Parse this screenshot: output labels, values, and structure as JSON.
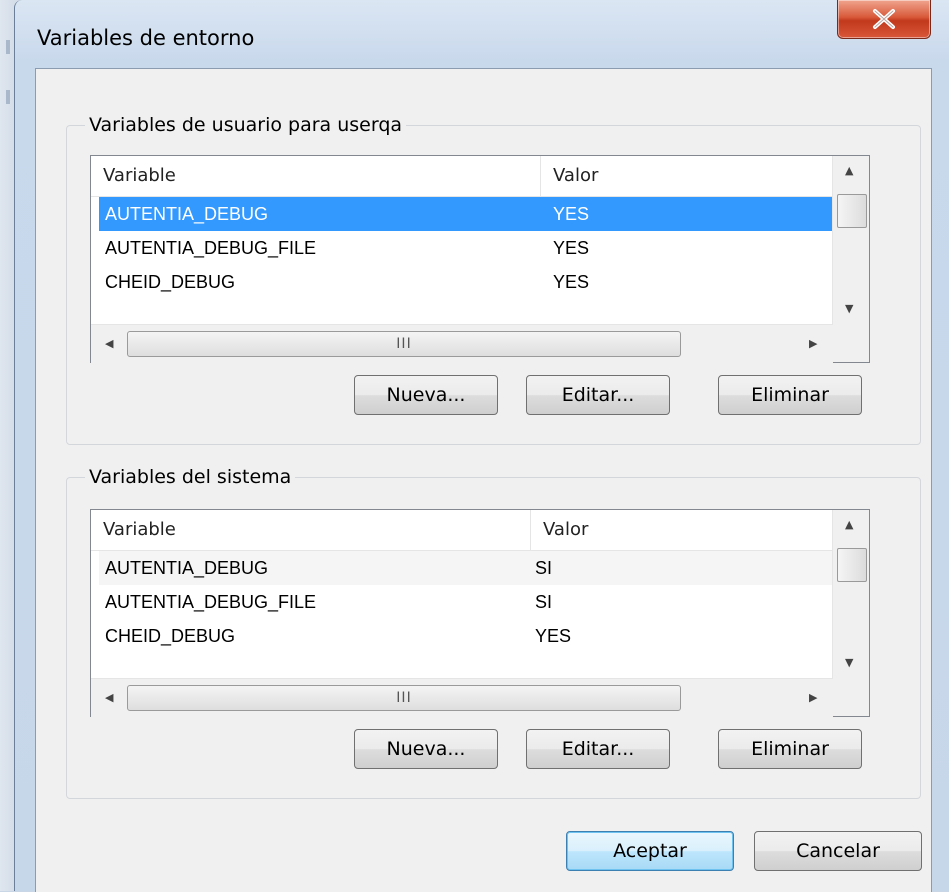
{
  "window": {
    "title": "Variables de entorno",
    "close_symbol": "✕"
  },
  "user_vars": {
    "group_label": "Variables de usuario para userqa",
    "columns": [
      "Variable",
      "Valor"
    ],
    "rows": [
      {
        "variable": "AUTENTIA_DEBUG",
        "value": "YES"
      },
      {
        "variable": "AUTENTIA_DEBUG_FILE",
        "value": "YES"
      },
      {
        "variable": "CHEID_DEBUG",
        "value": "YES"
      }
    ],
    "buttons": {
      "new": "Nueva...",
      "edit": "Editar...",
      "delete": "Eliminar"
    }
  },
  "system_vars": {
    "group_label": "Variables del sistema",
    "columns": [
      "Variable",
      "Valor"
    ],
    "rows": [
      {
        "variable": "AUTENTIA_DEBUG",
        "value": "SI"
      },
      {
        "variable": "AUTENTIA_DEBUG_FILE",
        "value": "SI"
      },
      {
        "variable": "CHEID_DEBUG",
        "value": "YES"
      }
    ],
    "buttons": {
      "new": "Nueva...",
      "edit": "Editar...",
      "delete": "Eliminar"
    }
  },
  "footer": {
    "ok": "Aceptar",
    "cancel": "Cancelar"
  },
  "scroll": {
    "grip": "III",
    "up": "▲",
    "down": "▼",
    "left": "◀",
    "right": "▶"
  },
  "colors": {
    "selection": "#3399ff",
    "close_button": "#c2391c"
  }
}
